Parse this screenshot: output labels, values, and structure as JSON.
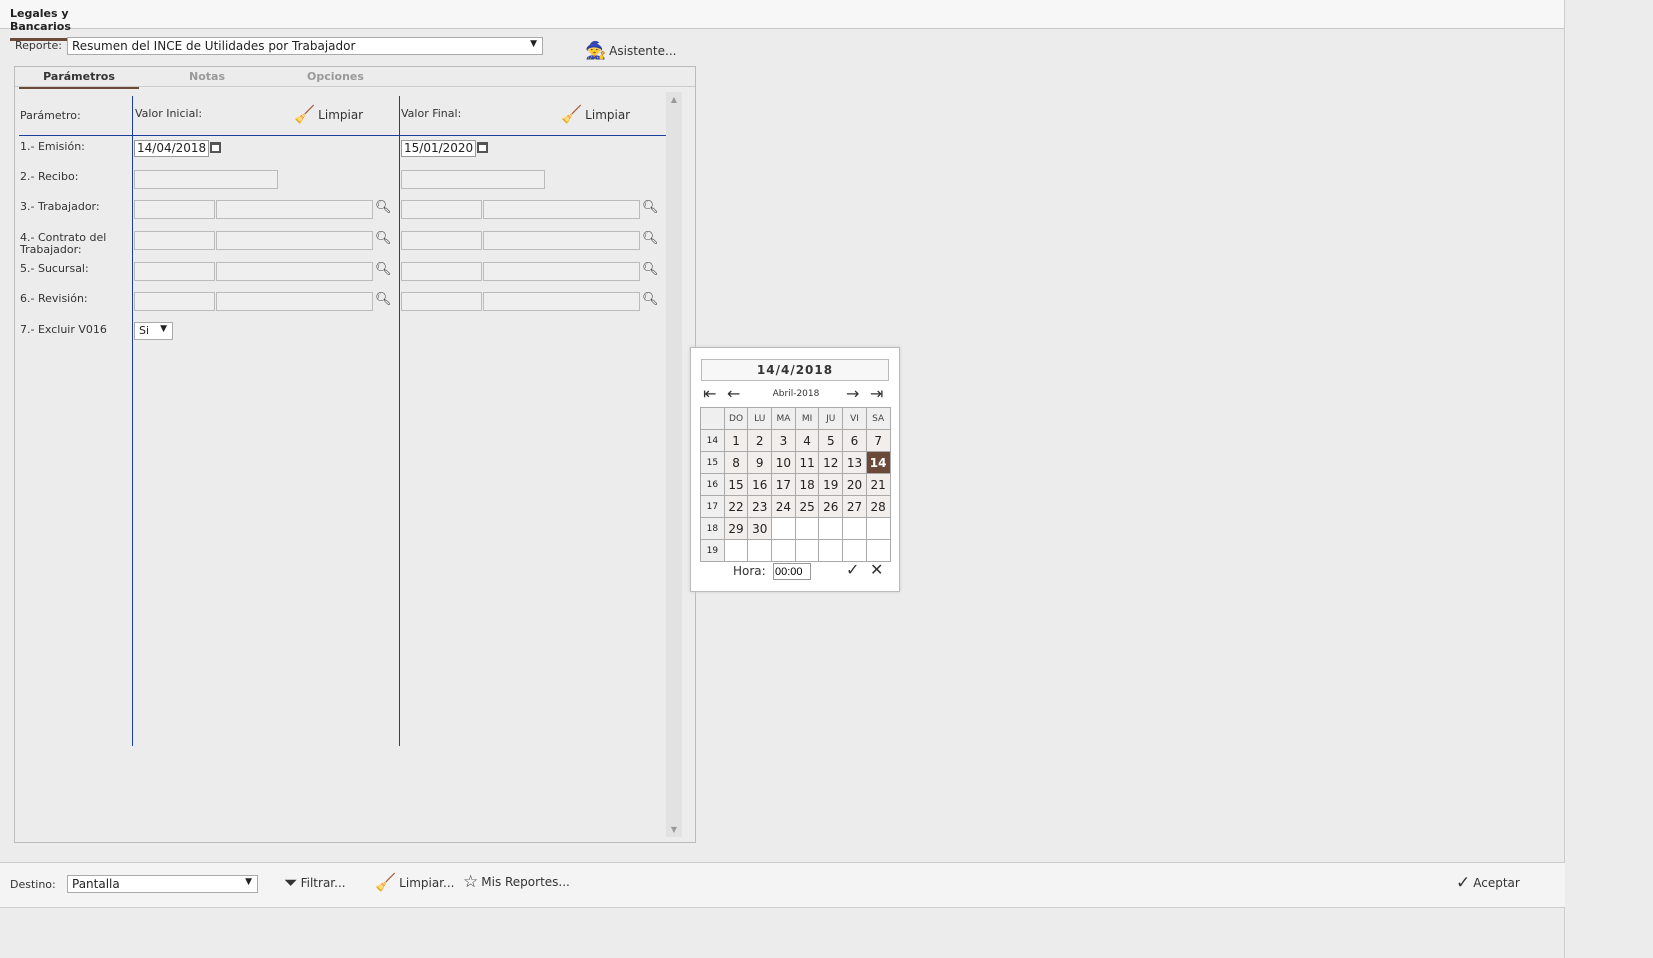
{
  "window": {
    "tab": "Legales y Bancarios"
  },
  "reporte": {
    "label": "Reporte:",
    "value": "Resumen del INCE de Utilidades por Trabajador",
    "wizard": "Asistente..."
  },
  "tabs": [
    "Parámetros",
    "Notas",
    "Opciones"
  ],
  "grid": {
    "param_header": "Parámetro:",
    "initial_header": "Valor Inicial:",
    "final_header": "Valor Final:",
    "clear": "Limpiar"
  },
  "params": [
    {
      "label": "1.- Emisión:",
      "type": "date",
      "initial": "14/04/2018",
      "final": "15/01/2020"
    },
    {
      "label": "2.- Recibo:",
      "type": "text"
    },
    {
      "label": "3.- Trabajador:",
      "type": "lookup"
    },
    {
      "label": "4.- Contrato del Trabajador:",
      "type": "lookup"
    },
    {
      "label": "5.- Sucursal:",
      "type": "lookup"
    },
    {
      "label": "6.- Revisión:",
      "type": "lookup"
    },
    {
      "label": "7.- Excluir V016",
      "type": "select",
      "value": "Si"
    }
  ],
  "calendar": {
    "title": "14/4/2018",
    "month": "Abril-2018",
    "days": [
      "DO",
      "LU",
      "MA",
      "MI",
      "JU",
      "VI",
      "SA"
    ],
    "weeks": [
      {
        "n": "14",
        "d": [
          "1",
          "2",
          "3",
          "4",
          "5",
          "6",
          "7"
        ]
      },
      {
        "n": "15",
        "d": [
          "8",
          "9",
          "10",
          "11",
          "12",
          "13",
          "14"
        ]
      },
      {
        "n": "16",
        "d": [
          "15",
          "16",
          "17",
          "18",
          "19",
          "20",
          "21"
        ]
      },
      {
        "n": "17",
        "d": [
          "22",
          "23",
          "24",
          "25",
          "26",
          "27",
          "28"
        ]
      },
      {
        "n": "18",
        "d": [
          "29",
          "30",
          "",
          "",
          "",
          "",
          ""
        ]
      },
      {
        "n": "19",
        "d": [
          "",
          "",
          "",
          "",
          "",
          "",
          ""
        ]
      }
    ],
    "selected": "14",
    "hora_label": "Hora:",
    "hora": "00:00",
    "accent": "#6b4a3a"
  },
  "bottom": {
    "destino_label": "Destino:",
    "destino": "Pantalla",
    "filter": "Filtrar...",
    "clear": "Limpiar...",
    "my_reports": "Mis Reportes...",
    "accept": "Aceptar"
  }
}
